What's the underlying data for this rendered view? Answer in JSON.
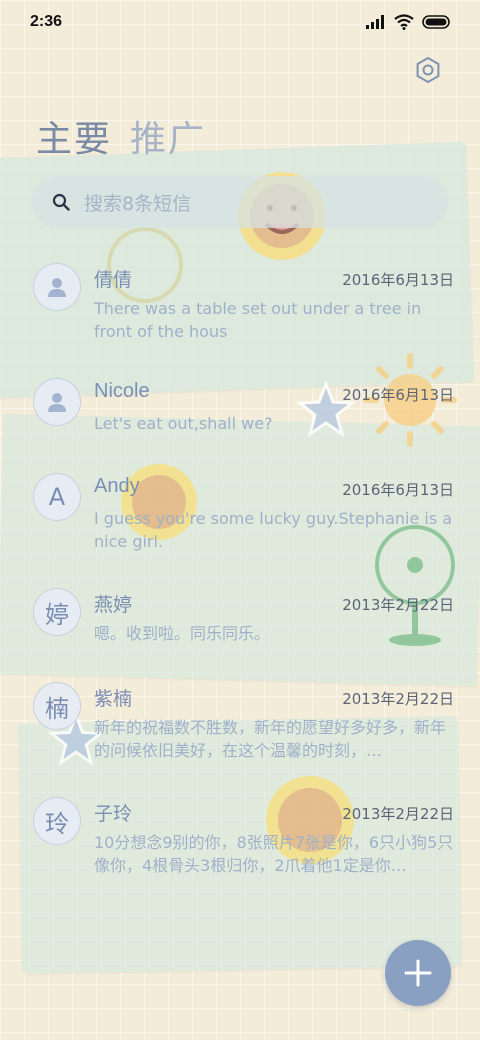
{
  "status_bar": {
    "time": "2:36"
  },
  "header": {
    "tabs": [
      {
        "label": "主要"
      },
      {
        "label": "推广"
      }
    ]
  },
  "search": {
    "placeholder": "搜索8条短信"
  },
  "conversations": [
    {
      "name": "倩倩",
      "date": "2016年6月13日",
      "preview": "There was a table set out under a tree in front of the hous",
      "avatar_letter": ""
    },
    {
      "name": "Nicole",
      "date": "2016年6月13日",
      "preview": "Let's eat out,shall we?",
      "avatar_letter": ""
    },
    {
      "name": "Andy",
      "date": "2016年6月13日",
      "preview": "I guess you're some lucky guy.Stephanie is a nice girl.",
      "avatar_letter": "A"
    },
    {
      "name": "燕婷",
      "date": "2013年2月22日",
      "preview": "嗯。收到啦。同乐同乐。",
      "avatar_letter": "婷"
    },
    {
      "name": "紫楠",
      "date": "2013年2月22日",
      "preview": "新年的祝福数不胜数，新年的愿望好多好多，新年的问候依旧美好，在这个温馨的时刻，…",
      "avatar_letter": "楠"
    },
    {
      "name": "子玲",
      "date": "2013年2月22日",
      "preview": "10分想念9别的你，8张照片7张是你，6只小狗5只像你，4根骨头3根归你，2爪着他1定是你…",
      "avatar_letter": "玲"
    }
  ],
  "colors": {
    "accent": "#8aa0c2",
    "name_text": "#7b8fb4",
    "preview_text": "#9fb0ca",
    "background": "#f3ecd8"
  },
  "icons": {
    "settings": "gear-icon",
    "search": "search-icon",
    "fab": "plus-icon",
    "default_avatar": "person-icon"
  }
}
